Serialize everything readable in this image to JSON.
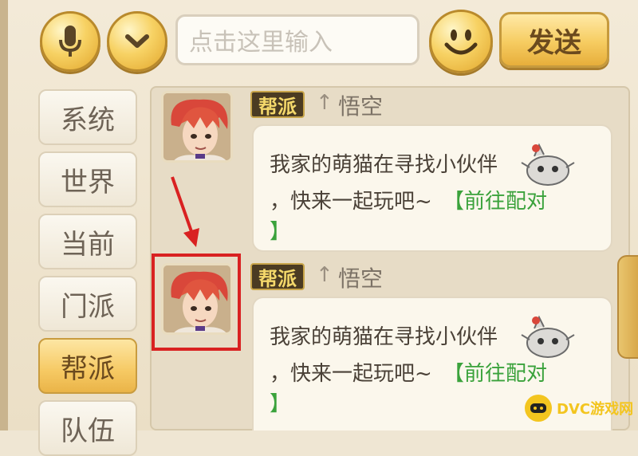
{
  "toolbar": {
    "mic_icon": "microphone-icon",
    "collapse_icon": "chevron-down-icon",
    "input_placeholder": "点击这里输入",
    "emoji_icon": "smiley-icon",
    "send_label": "发送"
  },
  "sidebar": {
    "tabs": [
      {
        "label": "系统"
      },
      {
        "label": "世界"
      },
      {
        "label": "当前"
      },
      {
        "label": "门派"
      },
      {
        "label": "帮派",
        "active": true
      },
      {
        "label": "队伍"
      }
    ]
  },
  "messages": [
    {
      "channel": "帮派",
      "rank": "↑",
      "name": "悟空",
      "line1": "我家的萌猫在寻找小伙伴",
      "line2": "，快来一起玩吧~",
      "link_open": "【前往配对",
      "link_close": "】"
    },
    {
      "channel": "帮派",
      "rank": "↑",
      "name": "悟空",
      "line1": "我家的萌猫在寻找小伙伴",
      "line2": "，快来一起玩吧~",
      "link_open": "【前往配对",
      "link_close": "】"
    }
  ],
  "watermark": {
    "text": "DVC游戏网"
  },
  "colors": {
    "accent": "#f6c963",
    "link": "#3aa23b",
    "highlight": "#d92121"
  }
}
